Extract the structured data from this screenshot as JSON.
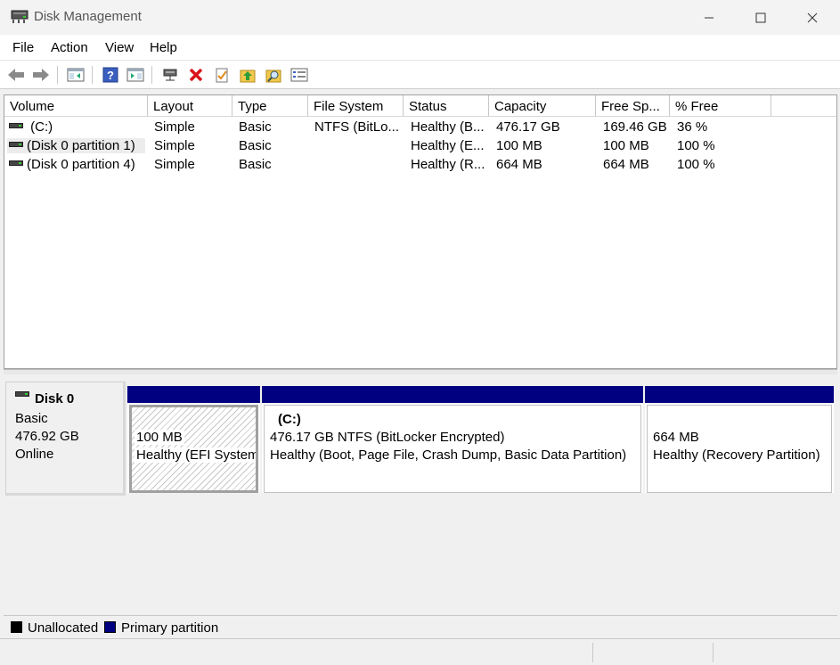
{
  "window": {
    "title": "Disk Management"
  },
  "menu": {
    "file": "File",
    "action": "Action",
    "view": "View",
    "help": "Help"
  },
  "toolbar": {
    "icons": [
      "back-icon",
      "forward-icon",
      "console-tree-icon",
      "help-icon",
      "show-hide-pane-icon",
      "connect-icon",
      "delete-icon",
      "properties-icon",
      "import-icon",
      "search-icon",
      "list-icon"
    ]
  },
  "columns": [
    "Volume",
    "Layout",
    "Type",
    "File System",
    "Status",
    "Capacity",
    "Free Sp...",
    "% Free"
  ],
  "volumes": [
    {
      "volume": "(C:)",
      "layout": "Simple",
      "type": "Basic",
      "fs": "NTFS (BitLo...",
      "status": "Healthy (B...",
      "capacity": "476.17 GB",
      "free": "169.46 GB",
      "pct": "36 %"
    },
    {
      "volume": "(Disk 0 partition 1)",
      "layout": "Simple",
      "type": "Basic",
      "fs": "",
      "status": "Healthy (E...",
      "capacity": "100 MB",
      "free": "100 MB",
      "pct": "100 %"
    },
    {
      "volume": "(Disk 0 partition 4)",
      "layout": "Simple",
      "type": "Basic",
      "fs": "",
      "status": "Healthy (R...",
      "capacity": "664 MB",
      "free": "664 MB",
      "pct": "100 %"
    }
  ],
  "disk": {
    "name": "Disk 0",
    "type": "Basic",
    "size": "476.92 GB",
    "state": "Online"
  },
  "partitions": [
    {
      "line1": "100 MB",
      "line2": "Healthy (EFI System"
    },
    {
      "name": "(C:)",
      "line1": "476.17 GB NTFS (BitLocker Encrypted)",
      "line2": "Healthy (Boot, Page File, Crash Dump, Basic Data Partition)"
    },
    {
      "line1": "664 MB",
      "line2": "Healthy (Recovery Partition)"
    }
  ],
  "legend": {
    "unallocated": "Unallocated",
    "primary": "Primary partition",
    "unallocated_color": "#000000",
    "primary_color": "#000080"
  }
}
